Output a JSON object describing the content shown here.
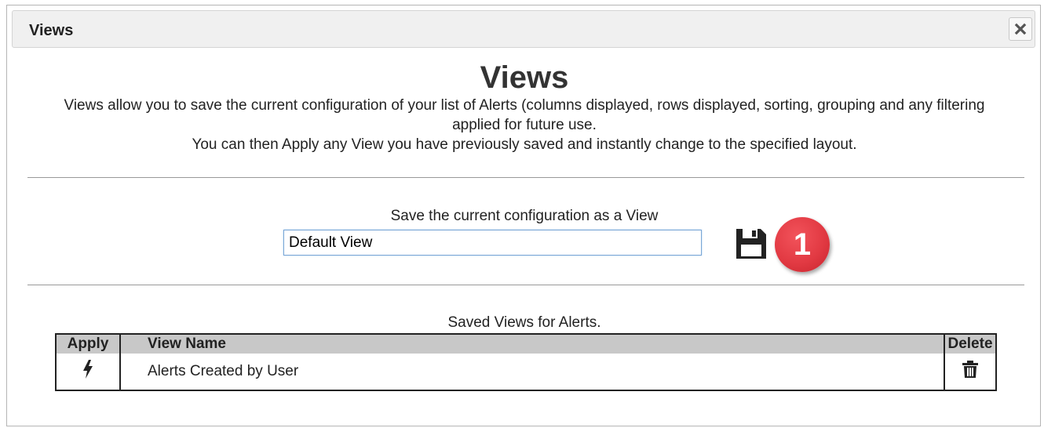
{
  "dialog": {
    "title": "Views",
    "close_icon": "close-icon"
  },
  "content": {
    "heading": "Views",
    "description_line1": "Views allow you to save the current configuration of your list of Alerts (columns displayed, rows displayed, sorting, grouping and any filtering applied for future use.",
    "description_line2": "You can then Apply any View you have previously saved and instantly change to the specified layout."
  },
  "save_section": {
    "label": "Save the current configuration as a View",
    "input_value": "Default View",
    "save_icon": "floppy-disk-icon",
    "badge_number": "1",
    "badge_color": "#e23a43"
  },
  "saved_views": {
    "label": "Saved Views for Alerts.",
    "columns": [
      "Apply",
      "View Name",
      "Delete"
    ],
    "rows": [
      {
        "apply_icon": "lightning-bolt-icon",
        "name": "Alerts Created by User",
        "delete_icon": "trash-icon"
      }
    ]
  }
}
